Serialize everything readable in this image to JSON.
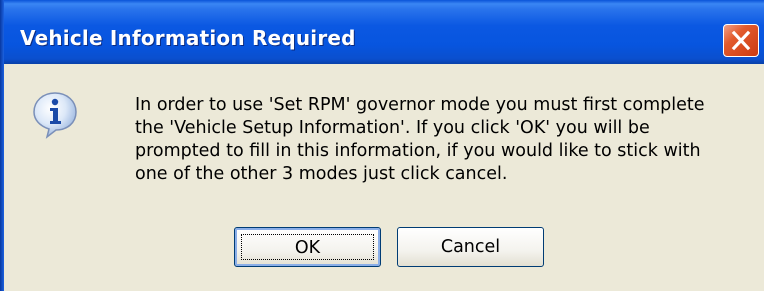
{
  "dialog": {
    "title": "Vehicle Information Required",
    "icon": "information-icon",
    "message_lines": [
      "In order to use 'Set RPM' governor mode you must first complete",
      "the 'Vehicle Setup Information'.  If you click 'OK' you will be",
      "prompted to fill in this information, if you would like to stick with",
      "one of the other 3 modes just click cancel."
    ],
    "buttons": {
      "ok_label": "OK",
      "cancel_label": "Cancel"
    },
    "close_icon": "close-icon"
  },
  "colors": {
    "titlebar": "#0755df",
    "dialog_background": "#ece9d8",
    "close_button": "#e25a2c"
  }
}
